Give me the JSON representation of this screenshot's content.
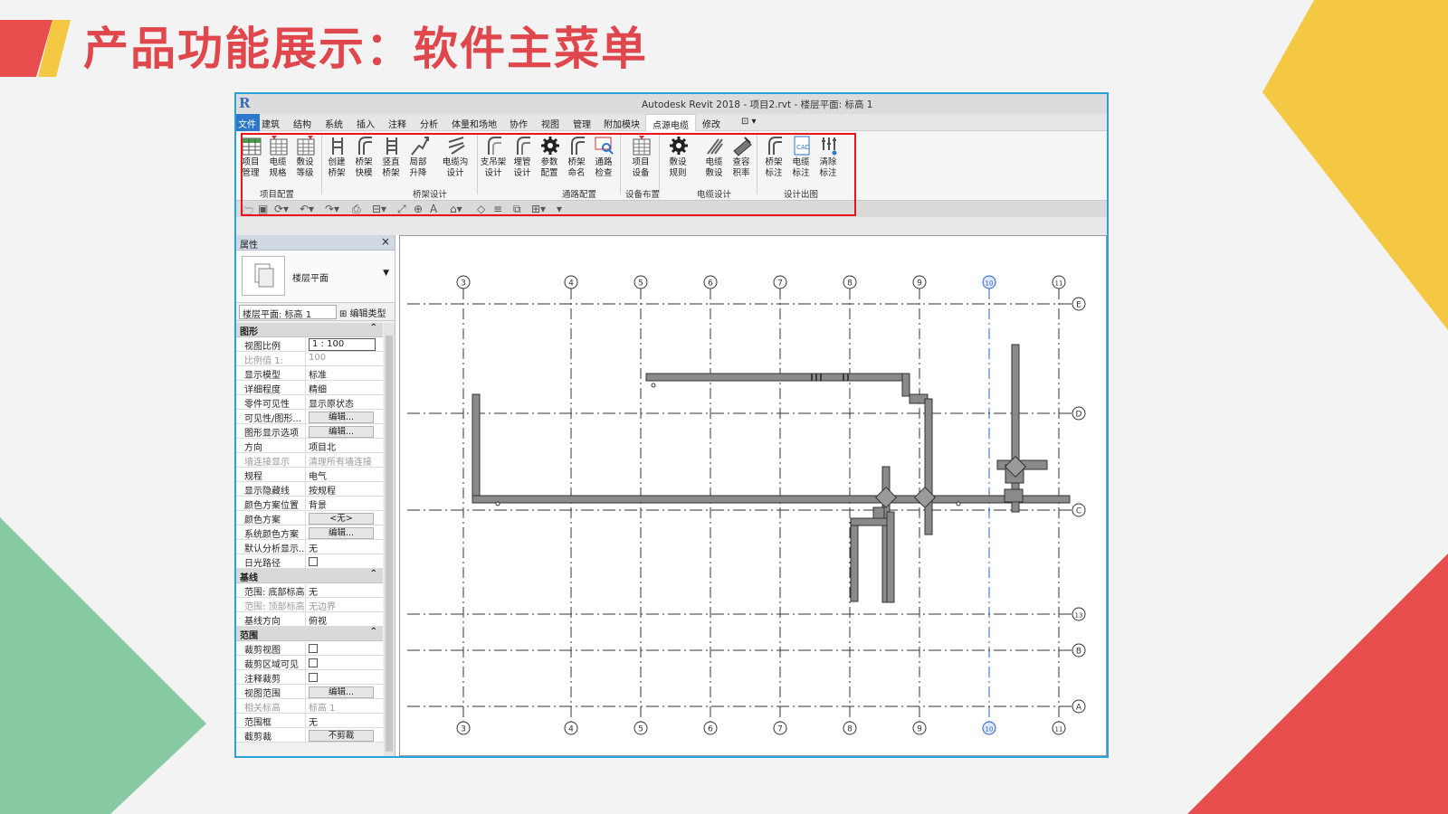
{
  "slide": {
    "title": "产品功能展示：软件主菜单",
    "colors": {
      "title": "#e0474c",
      "red": "#e84d4d",
      "yellow": "#f5c844",
      "green": "#86c9a2",
      "border": "#27a4dc"
    }
  },
  "window": {
    "title": "Autodesk Revit 2018 -    项目2.rvt - 楼层平面: 标高 1",
    "logo": "R"
  },
  "menu": {
    "tabs": [
      "文件",
      "建筑",
      "结构",
      "系统",
      "插入",
      "注释",
      "分析",
      "体量和场地",
      "协作",
      "视图",
      "管理",
      "附加模块",
      "点源电缆",
      "修改",
      "⊡ ▾"
    ],
    "active_tab": "点源电缆"
  },
  "ribbon": {
    "groups": [
      {
        "label": "项目配置",
        "buttons": [
          "项目\n管理",
          "电缆\n规格",
          "敷设\n等级"
        ]
      },
      {
        "label": "桥架设计",
        "buttons": [
          "创建\n桥架",
          "桥架\n快模",
          "竖直\n桥架",
          "局部\n升降",
          "电缆沟\n设计"
        ]
      },
      {
        "label": "通路配置",
        "buttons": [
          "支吊架\n设计",
          "埋管\n设计",
          "参数\n配置",
          "桥架\n命名",
          "通路\n检查"
        ]
      },
      {
        "label": "设备布置",
        "buttons": [
          "项目\n设备"
        ]
      },
      {
        "label": "电缆设计",
        "buttons": [
          "敷设\n规则",
          "电缆\n敷设",
          "查容\n积率"
        ]
      },
      {
        "label": "设计出图",
        "buttons": [
          "桥架\n标注",
          "电缆\n标注",
          "清除\n标注"
        ]
      }
    ]
  },
  "properties": {
    "title": "属性",
    "close": "×",
    "type_name": "楼层平面",
    "instance_selector": "楼层平面: 标高 1",
    "edit_type": "编辑类型",
    "sections": [
      {
        "name": "图形",
        "rows": [
          {
            "key": "视图比例",
            "value": "1 : 100",
            "kind": "input"
          },
          {
            "key": "比例值 1:",
            "value": "100",
            "kind": "dim"
          },
          {
            "key": "显示模型",
            "value": "标准"
          },
          {
            "key": "详细程度",
            "value": "精细"
          },
          {
            "key": "零件可见性",
            "value": "显示原状态"
          },
          {
            "key": "可见性/图形...",
            "value": "编辑...",
            "kind": "button"
          },
          {
            "key": "图形显示选项",
            "value": "编辑...",
            "kind": "button"
          },
          {
            "key": "方向",
            "value": "项目北"
          },
          {
            "key": "墙连接显示",
            "value": "清理所有墙连接",
            "kind": "dim"
          },
          {
            "key": "规程",
            "value": "电气"
          },
          {
            "key": "显示隐藏线",
            "value": "按规程"
          },
          {
            "key": "颜色方案位置",
            "value": "背景"
          },
          {
            "key": "颜色方案",
            "value": "<无>",
            "kind": "button"
          },
          {
            "key": "系统颜色方案",
            "value": "编辑...",
            "kind": "button"
          },
          {
            "key": "默认分析显示...",
            "value": "无"
          },
          {
            "key": "日光路径",
            "value": "",
            "kind": "check"
          }
        ]
      },
      {
        "name": "基线",
        "rows": [
          {
            "key": "范围: 底部标高",
            "value": "无"
          },
          {
            "key": "范围: 顶部标高",
            "value": "无边界",
            "kind": "dim"
          },
          {
            "key": "基线方向",
            "value": "俯视"
          }
        ]
      },
      {
        "name": "范围",
        "rows": [
          {
            "key": "裁剪视图",
            "value": "",
            "kind": "check"
          },
          {
            "key": "裁剪区域可见",
            "value": "",
            "kind": "check"
          },
          {
            "key": "注释裁剪",
            "value": "",
            "kind": "check"
          },
          {
            "key": "视图范围",
            "value": "编辑...",
            "kind": "button"
          },
          {
            "key": "相关标高",
            "value": "标高 1",
            "kind": "dim"
          },
          {
            "key": "范围框",
            "value": "无"
          },
          {
            "key": "截剪裁",
            "value": "不剪裁",
            "kind": "button"
          }
        ]
      }
    ]
  },
  "grid": {
    "vertical": [
      "3",
      "4",
      "5",
      "6",
      "7",
      "8",
      "9",
      "10",
      "11"
    ],
    "horizontal": [
      "E",
      "D",
      "C",
      "13",
      "B",
      "A"
    ],
    "selected": "10"
  }
}
